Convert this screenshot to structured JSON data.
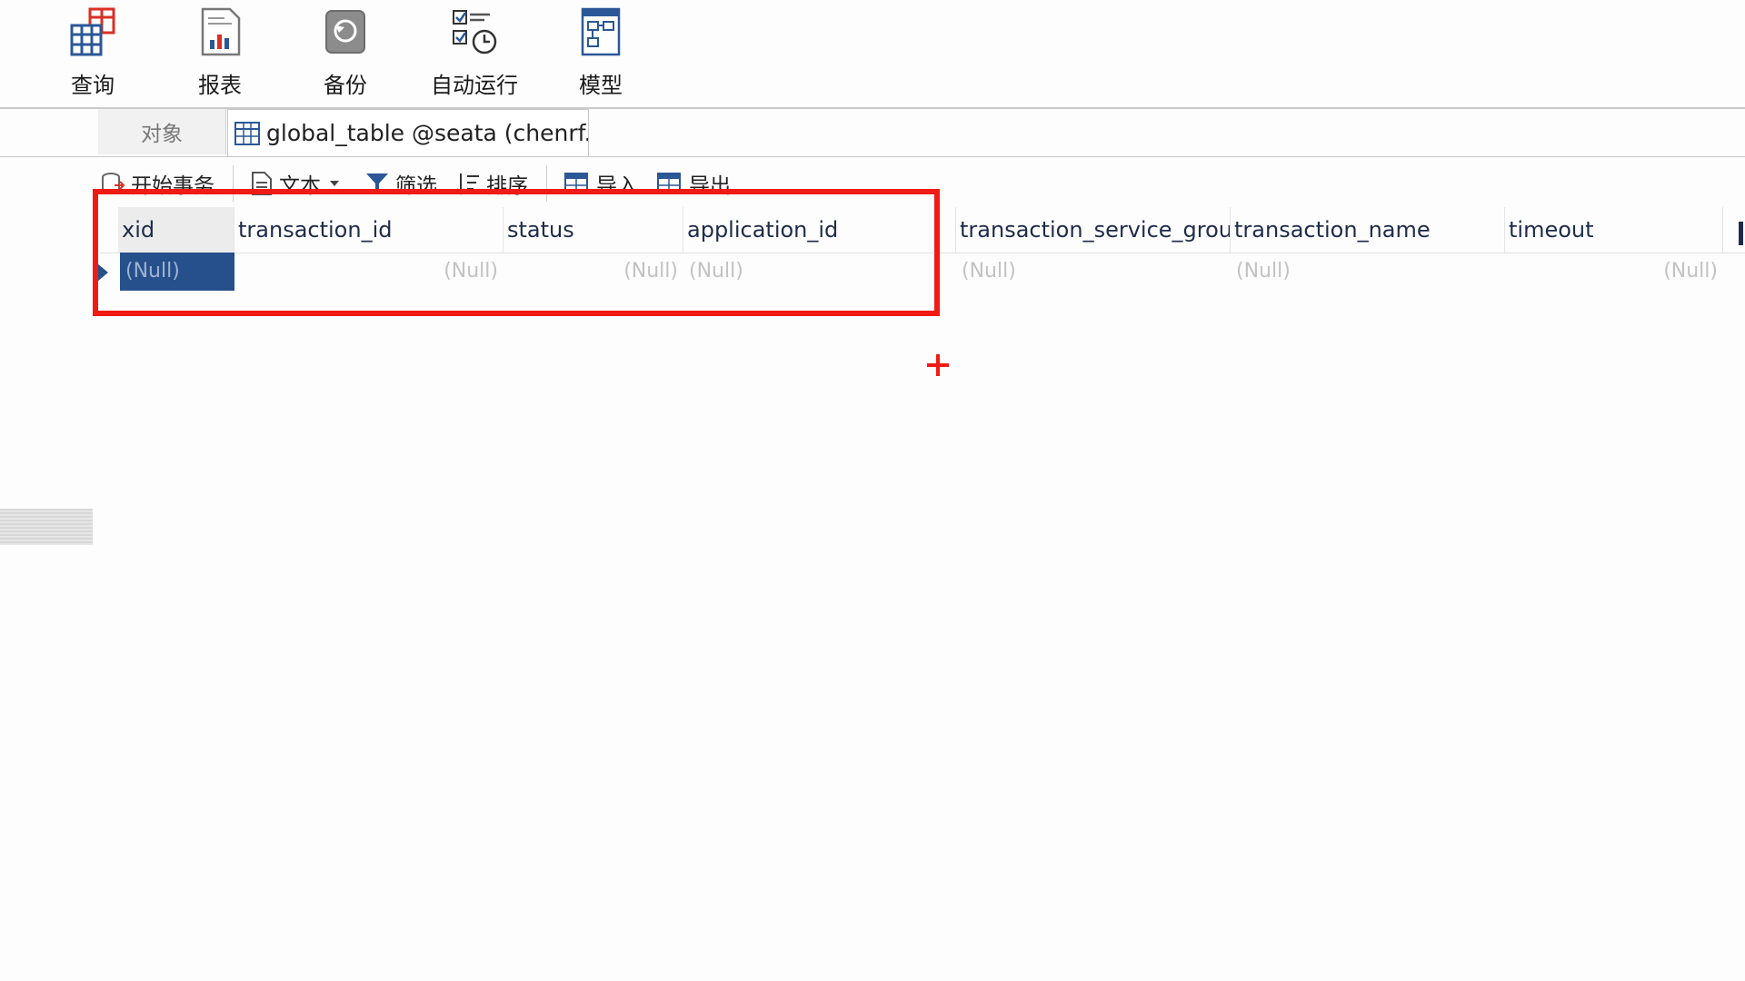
{
  "ribbon": {
    "items": [
      {
        "label": "查询",
        "icon": "query-grid-icon"
      },
      {
        "label": "报表",
        "icon": "report-chart-icon"
      },
      {
        "label": "备份",
        "icon": "backup-icon"
      },
      {
        "label": "自动运行",
        "icon": "auto-run-checklist-icon"
      },
      {
        "label": "模型",
        "icon": "model-diagram-icon"
      }
    ]
  },
  "tabs": {
    "objects_label": "对象",
    "active_tab_label": "global_table @seata (chenrf..."
  },
  "toolbar": {
    "begin_transaction": "开始事务",
    "text": "文本",
    "filter": "筛选",
    "sort": "排序",
    "import": "导入",
    "export": "导出"
  },
  "grid": {
    "columns": [
      "xid",
      "transaction_id",
      "status",
      "application_id",
      "transaction_service_group",
      "transaction_name",
      "timeout"
    ],
    "rows": [
      [
        "(Null)",
        "(Null)",
        "(Null)",
        "(Null)",
        "(Null)",
        "(Null)",
        "(Null)"
      ]
    ]
  },
  "colors": {
    "highlight": "#f01b14",
    "selection": "#26508c",
    "null_text": "#c2c2c2"
  }
}
